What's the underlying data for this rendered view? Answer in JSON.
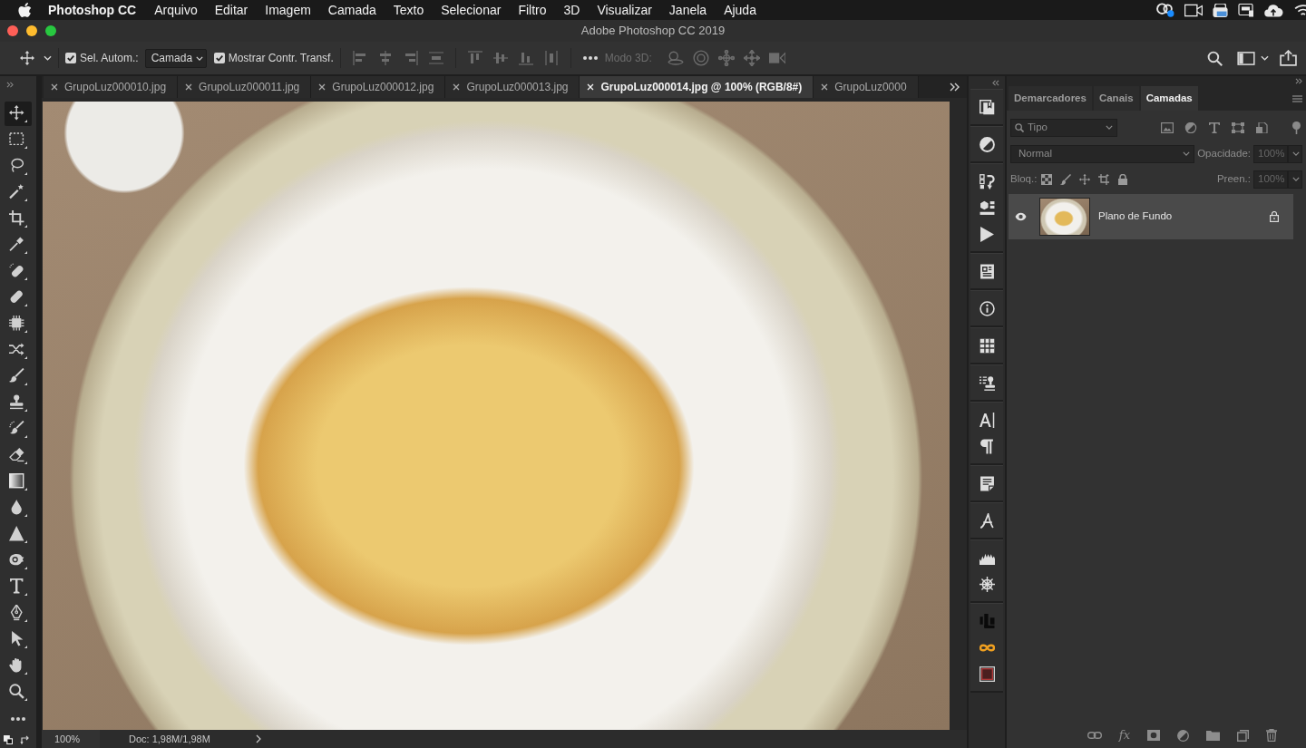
{
  "menubar": {
    "app_name": "Photoshop CC",
    "menus": [
      "Arquivo",
      "Editar",
      "Imagem",
      "Camada",
      "Texto",
      "Selecionar",
      "Filtro",
      "3D",
      "Visualizar",
      "Janela",
      "Ajuda"
    ]
  },
  "window": {
    "title": "Adobe Photoshop CC 2019"
  },
  "options_bar": {
    "auto_select": {
      "label": "Sel. Autom.:",
      "checked": true
    },
    "auto_select_target": "Camada",
    "show_transform_controls": {
      "label": "Mostrar Contr. Transf.",
      "checked": true
    },
    "mode_3d_label": "Modo 3D:"
  },
  "document_tabs": [
    {
      "label": "GrupoLuz000010.jpg",
      "selected": false
    },
    {
      "label": "GrupoLuz000011.jpg",
      "selected": false
    },
    {
      "label": "GrupoLuz000012.jpg",
      "selected": false
    },
    {
      "label": "GrupoLuz000013.jpg",
      "selected": false
    },
    {
      "label": "GrupoLuz000014.jpg @ 100% (RGB/8#)",
      "selected": true
    },
    {
      "label": "GrupoLuz0000",
      "selected": false
    }
  ],
  "toolbar": {
    "tools": [
      {
        "kind": "move",
        "selected": true
      },
      {
        "kind": "marquee",
        "selected": false
      },
      {
        "kind": "lasso",
        "selected": false
      },
      {
        "kind": "wand",
        "selected": false
      },
      {
        "kind": "crop",
        "selected": false
      },
      {
        "kind": "eyedropper",
        "selected": false
      },
      {
        "kind": "spot_healing",
        "selected": false
      },
      {
        "kind": "healing",
        "selected": false
      },
      {
        "kind": "chip",
        "selected": false
      },
      {
        "kind": "shuffle",
        "selected": false
      },
      {
        "kind": "brush",
        "selected": false
      },
      {
        "kind": "stamp",
        "selected": false
      },
      {
        "kind": "history_brush",
        "selected": false
      },
      {
        "kind": "eraser",
        "selected": false
      },
      {
        "kind": "gradient",
        "selected": false
      },
      {
        "kind": "drop",
        "selected": false
      },
      {
        "kind": "triangle",
        "selected": false
      },
      {
        "kind": "sponge",
        "selected": false
      },
      {
        "kind": "type",
        "selected": false
      },
      {
        "kind": "pen",
        "selected": false
      },
      {
        "kind": "pointer",
        "selected": false
      },
      {
        "kind": "hand",
        "selected": false
      },
      {
        "kind": "zoom",
        "selected": false
      },
      {
        "kind": "more",
        "selected": false
      }
    ]
  },
  "status_bar": {
    "zoom": "100%",
    "doc_info": "Doc: 1,98M/1,98M"
  },
  "layers_panel": {
    "tabs": [
      {
        "label": "Demarcadores",
        "selected": false
      },
      {
        "label": "Canais",
        "selected": false
      },
      {
        "label": "Camadas",
        "selected": true
      }
    ],
    "filter": "Tipo",
    "blend_mode": {
      "value": "Normal",
      "disabled": true
    },
    "opacity": {
      "label": "Opacidade:",
      "value": "100%",
      "disabled": true
    },
    "lock_label": "Bloq.:",
    "fill": {
      "label": "Preen.:",
      "value": "100%",
      "disabled": true
    },
    "layers": [
      {
        "name": "Plano de Fundo",
        "visible": true,
        "locked": true,
        "selected": true
      }
    ],
    "fx_label": "fx"
  }
}
